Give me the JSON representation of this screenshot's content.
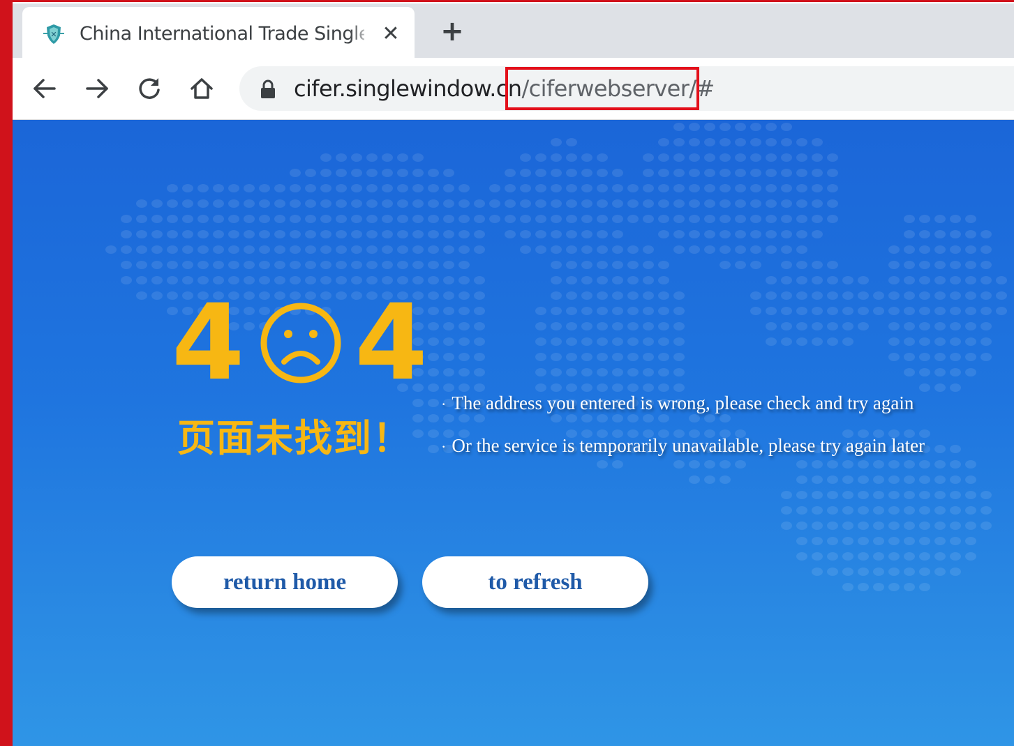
{
  "browser": {
    "tab": {
      "title": "China International Trade Single Window",
      "close_glyph": "✕",
      "favicon": "shield-favicon-icon"
    },
    "new_tab_glyph": "+",
    "nav": {
      "back": "back-arrow-icon",
      "forward": "forward-arrow-icon",
      "reload": "reload-icon",
      "home": "home-icon"
    },
    "address_bar": {
      "host": "cifer.singlewindow.cn",
      "path": "/ciferwebserver/#",
      "secure_icon": "lock-icon"
    },
    "colors": {
      "tabstrip": "#dee1e6",
      "highlight_box": "#e3101b"
    }
  },
  "page": {
    "error_code_digit_left": "4",
    "error_code_digit_right": "4",
    "sad_face_icon": "sad-face-icon",
    "heading_cn": "页面未找到！",
    "messages": [
      "The address you entered is wrong, please check and try again",
      "Or the service is temporarily unavailable, please try again later"
    ],
    "bullet": "·",
    "buttons": {
      "return_home": "return home",
      "refresh": "to refresh"
    },
    "colors": {
      "background_top": "#1b66d8",
      "background_bottom": "#2f95e6",
      "accent_yellow": "#f7b713",
      "button_text": "#1f5aa8"
    }
  }
}
